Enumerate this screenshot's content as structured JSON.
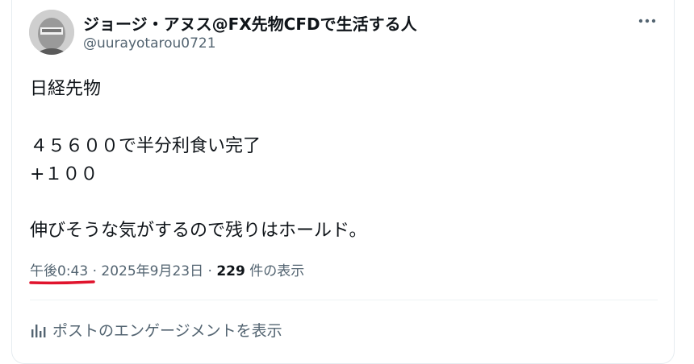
{
  "author": {
    "display_name": "ジョージ・アヌス@FX先物CFDで生活する人",
    "handle": "@uurayotarou0721"
  },
  "tweet": {
    "line1": "日経先物",
    "line2": "４５６００で半分利食い完了",
    "line3": "+１００",
    "line4": "伸びそうな気がするので残りはホールド。"
  },
  "meta": {
    "time": "午後0:43",
    "sep1": " · ",
    "date": "2025年9月23日",
    "sep2": " · ",
    "views_count": "229",
    "views_label": " 件の表示"
  },
  "engagement": {
    "label": "ポストのエンゲージメントを表示"
  },
  "icons": {
    "more": "more-horizontal-icon",
    "engagement": "bar-chart-icon"
  },
  "colors": {
    "text_primary": "#0f1419",
    "text_secondary": "#536471",
    "annotation": "#e0142d"
  }
}
